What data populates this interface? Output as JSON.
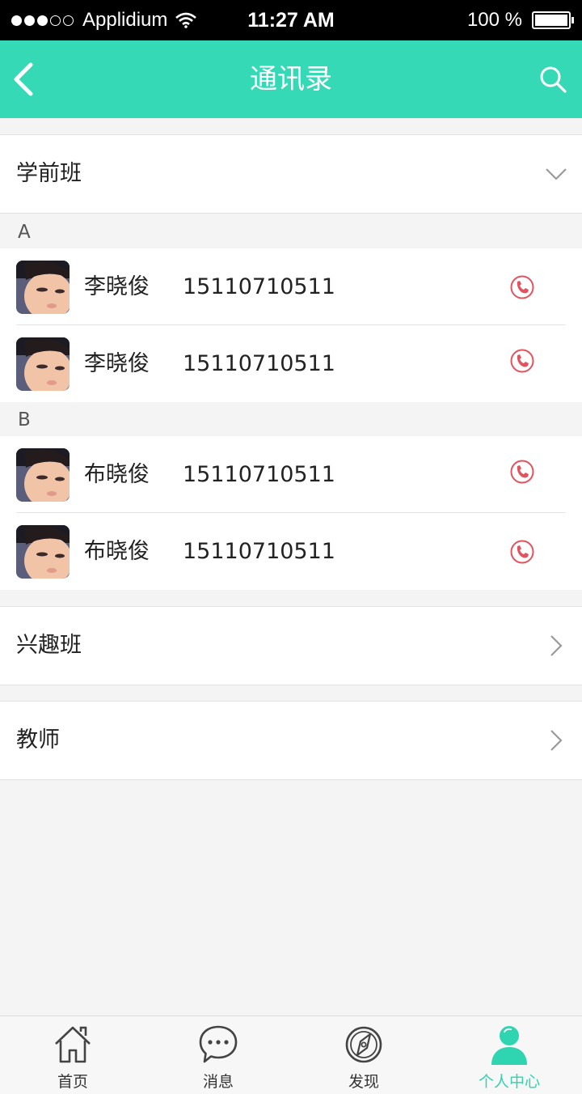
{
  "status_bar": {
    "carrier": "Applidium",
    "time": "11:27 AM",
    "battery": "100 %"
  },
  "nav": {
    "title": "通讯录",
    "back_icon": "chevron-left-icon",
    "search_icon": "search-icon"
  },
  "groups": {
    "preschool": {
      "label": "学前班",
      "state": "expanded"
    },
    "interest": {
      "label": "兴趣班",
      "state": "collapsed"
    },
    "teachers": {
      "label": "教师",
      "state": "collapsed"
    }
  },
  "sections": [
    {
      "letter": "A",
      "contacts": [
        {
          "name": "李晓俊",
          "phone": "15110710511"
        },
        {
          "name": "李晓俊",
          "phone": "15110710511"
        }
      ]
    },
    {
      "letter": "B",
      "contacts": [
        {
          "name": "布晓俊",
          "phone": "15110710511"
        },
        {
          "name": "布晓俊",
          "phone": "15110710511"
        }
      ]
    }
  ],
  "tabbar": {
    "tabs": [
      {
        "label": "首页",
        "icon": "home-icon"
      },
      {
        "label": "消息",
        "icon": "chat-bubble-icon"
      },
      {
        "label": "发现",
        "icon": "compass-icon"
      },
      {
        "label": "个人中心",
        "icon": "person-icon",
        "active": true
      }
    ]
  },
  "colors": {
    "accent": "#36d9b6",
    "call": "#e2535f"
  }
}
